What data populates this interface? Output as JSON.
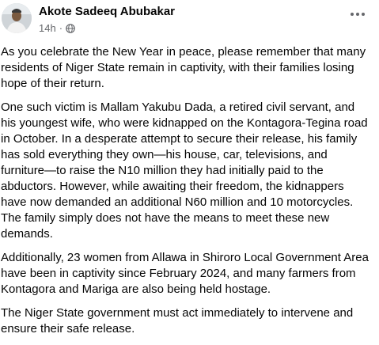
{
  "post": {
    "author": "Akote Sadeeq Abubakar",
    "time": "14h",
    "separator": "·",
    "paragraphs": [
      "As you celebrate the New Year in peace, please remember that many residents of Niger State remain in captivity, with their families losing hope of their return.",
      "One such victim is Mallam Yakubu Dada, a retired civil servant, and his youngest wife, who were kidnapped on the Kontagora-Tegina road in October. In a desperate attempt to secure their release, his family has sold everything they own—his house, car, televisions, and furniture—to raise the N10 million they had initially paid to the abductors. However, while awaiting their freedom, the kidnappers have now demanded an additional N60 million and 10 motorcycles. The family simply does not have the means to meet these new demands.",
      "Additionally, 23 women from Allawa in Shiroro Local Government Area have been in captivity since February 2024, and many farmers from Kontagora and Mariga are also being held hostage.",
      "The Niger State government must act immediately to intervene and ensure their safe release."
    ]
  },
  "icons": {
    "avatar": "profile-photo",
    "audience": "globe-icon",
    "menu": "more-options-icon"
  },
  "colors": {
    "text": "#050505",
    "secondary": "#65676b",
    "background": "#ffffff"
  }
}
